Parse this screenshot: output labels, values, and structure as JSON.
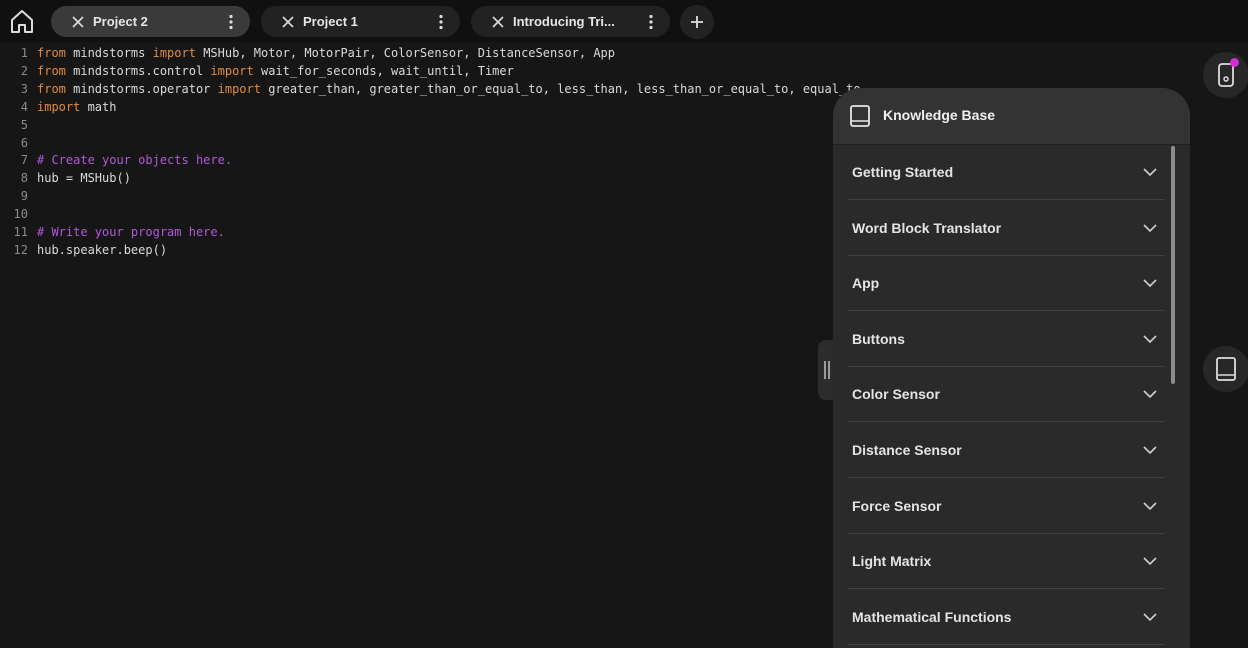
{
  "tabs": [
    {
      "label": "Project 2",
      "active": true
    },
    {
      "label": "Project 1",
      "active": false
    },
    {
      "label": "Introducing Tri...",
      "active": false
    }
  ],
  "editor": {
    "lines": [
      {
        "n": "1",
        "parts": [
          {
            "t": "kw",
            "s": "from"
          },
          {
            "t": "tx",
            "s": " mindstorms "
          },
          {
            "t": "kw",
            "s": "import"
          },
          {
            "t": "tx",
            "s": " MSHub, Motor, MotorPair, ColorSensor, DistanceSensor, App"
          }
        ]
      },
      {
        "n": "2",
        "parts": [
          {
            "t": "kw",
            "s": "from"
          },
          {
            "t": "tx",
            "s": " mindstorms.control "
          },
          {
            "t": "kw",
            "s": "import"
          },
          {
            "t": "tx",
            "s": " wait_for_seconds, wait_until, Timer"
          }
        ]
      },
      {
        "n": "3",
        "parts": [
          {
            "t": "kw",
            "s": "from"
          },
          {
            "t": "tx",
            "s": " mindstorms.operator "
          },
          {
            "t": "kw",
            "s": "import"
          },
          {
            "t": "tx",
            "s": " greater_than, greater_than_or_equal_to, less_than, less_than_or_equal_to, equal_to,"
          }
        ]
      },
      {
        "n": "4",
        "parts": [
          {
            "t": "kw",
            "s": "import"
          },
          {
            "t": "tx",
            "s": " math"
          }
        ]
      },
      {
        "n": "5",
        "parts": []
      },
      {
        "n": "6",
        "parts": []
      },
      {
        "n": "7",
        "parts": [
          {
            "t": "cm",
            "s": "# Create your objects here."
          }
        ]
      },
      {
        "n": "8",
        "parts": [
          {
            "t": "tx",
            "s": "hub = MSHub()"
          }
        ]
      },
      {
        "n": "9",
        "parts": []
      },
      {
        "n": "10",
        "parts": []
      },
      {
        "n": "11",
        "parts": [
          {
            "t": "cm",
            "s": "# Write your program here."
          }
        ]
      },
      {
        "n": "12",
        "parts": [
          {
            "t": "tx",
            "s": "hub.speaker.beep()"
          }
        ]
      }
    ]
  },
  "knowledge_base": {
    "title": "Knowledge Base",
    "items": [
      "Getting Started",
      "Word Block Translator",
      "App",
      "Buttons",
      "Color Sensor",
      "Distance Sensor",
      "Force Sensor",
      "Light Matrix",
      "Mathematical Functions"
    ]
  },
  "colors": {
    "keyword": "#e48a3c",
    "comment": "#b258d6",
    "notification_dot": "#d12fd0"
  }
}
